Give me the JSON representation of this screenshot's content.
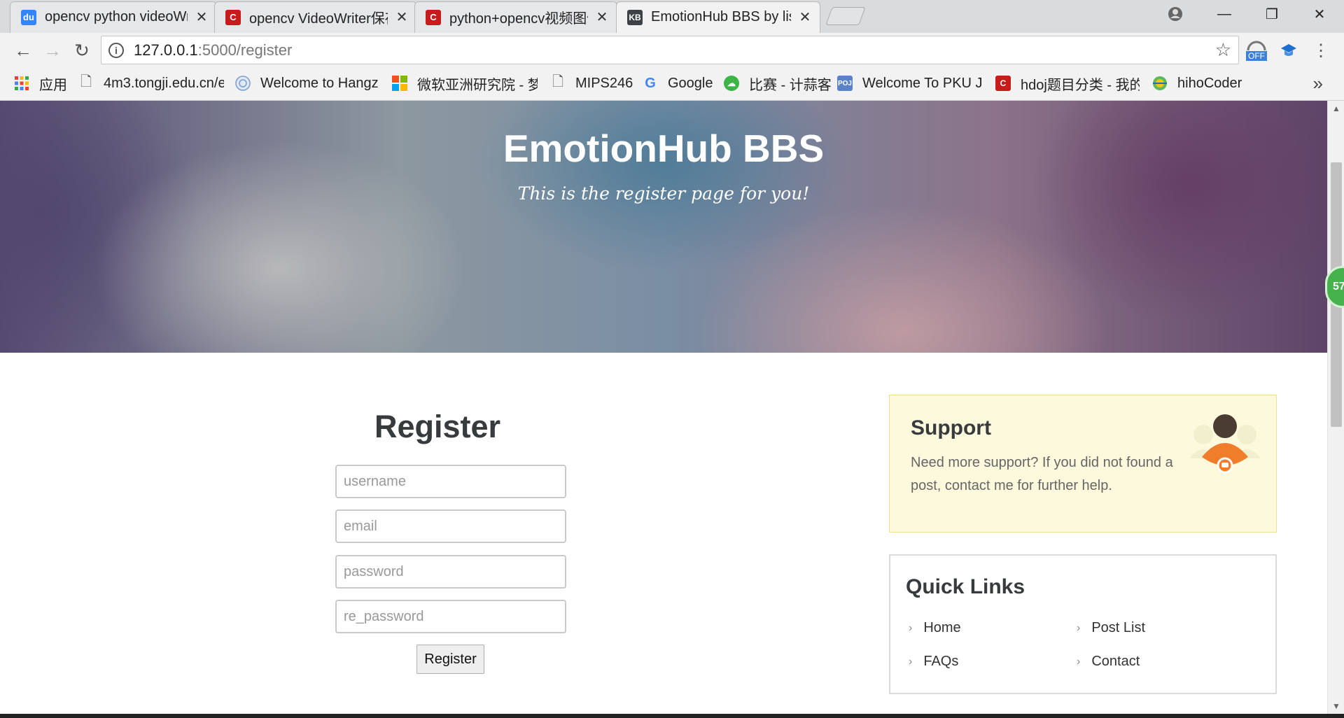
{
  "browser": {
    "tabs": [
      {
        "title": "opencv python videoWriter",
        "icon": "baidu-icon",
        "color": "#3385ff"
      },
      {
        "title": "opencv VideoWriter保存视频",
        "icon": "csdn-icon",
        "color": "#c81c1c"
      },
      {
        "title": "python+opencv视频图像",
        "icon": "csdn-icon",
        "color": "#c81c1c"
      },
      {
        "title": "EmotionHub BBS by lisha",
        "icon": "kb-icon",
        "color": "#3c4246",
        "active": true
      }
    ],
    "address": {
      "host": "127.0.0.1",
      "path": ":5000/register"
    },
    "ext_off_label": "OFF",
    "bookmarks": [
      {
        "label": "应用",
        "icon": "apps-grid-icon"
      },
      {
        "label": "4m3.tongji.edu.cn/e",
        "icon": "page-icon"
      },
      {
        "label": "Welcome to Hangzhou",
        "icon": "hdu-icon"
      },
      {
        "label": "微软亚洲研究院 - 梦想",
        "icon": "microsoft-icon"
      },
      {
        "label": "MIPS246",
        "icon": "page-icon"
      },
      {
        "label": "Google",
        "icon": "google-icon"
      },
      {
        "label": "比赛 - 计蒜客",
        "icon": "jisuanke-icon"
      },
      {
        "label": "Welcome To PKU Judge",
        "icon": "poj-icon",
        "badge": "POJ"
      },
      {
        "label": "hdoj题目分类 - 我的",
        "icon": "csdn-icon"
      },
      {
        "label": "hihoCoder",
        "icon": "hihocoder-icon"
      }
    ],
    "bookmarks_more": "»",
    "kb_favicon_text": "KB"
  },
  "hero": {
    "title": "EmotionHub BBS",
    "subtitle": "This is the register page for you!"
  },
  "register": {
    "heading": "Register",
    "username_placeholder": "username",
    "email_placeholder": "email",
    "password_placeholder": "password",
    "re_password_placeholder": "re_password",
    "submit_label": "Register"
  },
  "support": {
    "heading": "Support",
    "text": "Need more support? If you did not found a post, contact me for further help."
  },
  "quick_links": {
    "heading": "Quick Links",
    "items": [
      "Home",
      "Post List",
      "FAQs",
      "Contact"
    ]
  },
  "float_badge": "57"
}
